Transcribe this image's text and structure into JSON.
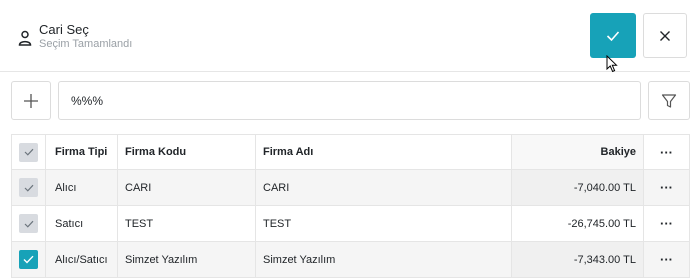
{
  "header": {
    "title": "Cari Seç",
    "subtitle": "Seçim Tamamlandı"
  },
  "toolbar": {
    "search_value": "%%%"
  },
  "table": {
    "columns": [
      "Firma Tipi",
      "Firma Kodu",
      "Firma Adı",
      "Bakiye"
    ],
    "more_label": "···",
    "rows": [
      {
        "tip": "Alıcı",
        "kod": "CARI",
        "adi": "CARI",
        "bakiye": "-7,040.00 TL",
        "checked": false
      },
      {
        "tip": "Satıcı",
        "kod": "TEST",
        "adi": "TEST",
        "bakiye": "-26,745.00 TL",
        "checked": false
      },
      {
        "tip": "Alıcı/Satıcı",
        "kod": "Simzet Yazılım",
        "adi": "Simzet Yazılım",
        "bakiye": "-7,343.00 TL",
        "checked": true
      }
    ]
  },
  "colors": {
    "accent": "#17a2b8",
    "checkbox_off": "#d8dbe0"
  }
}
